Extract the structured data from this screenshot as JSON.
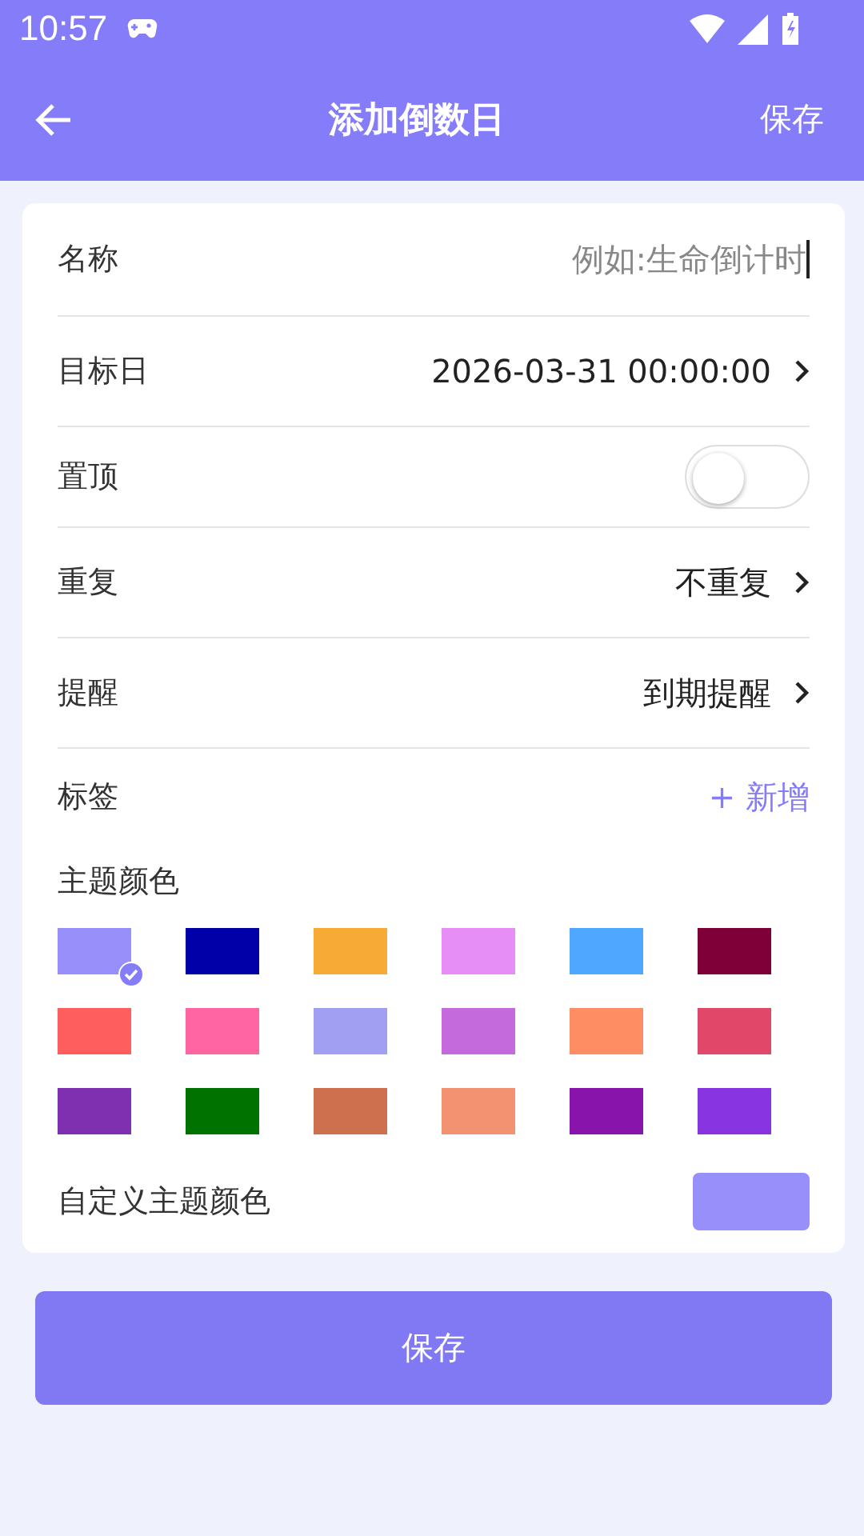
{
  "status_bar": {
    "time": "10:57"
  },
  "header": {
    "title": "添加倒数日",
    "action": "保存"
  },
  "rows": [
    {
      "kind": "input",
      "label": "名称",
      "placeholder": "例如:生命倒计时"
    },
    {
      "kind": "value",
      "label": "目标日",
      "value": "2026-03-31 00:00:00"
    },
    {
      "kind": "toggle",
      "label": "置顶",
      "on": false
    },
    {
      "kind": "value",
      "label": "重复",
      "value": "不重复"
    },
    {
      "kind": "value",
      "label": "提醒",
      "value": "到期提醒"
    },
    {
      "kind": "add",
      "label": "标签",
      "value": "+ 新增"
    }
  ],
  "theme": {
    "label": "主题颜色",
    "swatches": [
      {
        "color": "#978ffa",
        "selected": true
      },
      {
        "color": "#0000a8",
        "selected": false
      },
      {
        "color": "#f7aa35",
        "selected": false
      },
      {
        "color": "#e78ef6",
        "selected": false
      },
      {
        "color": "#4fa7ff",
        "selected": false
      },
      {
        "color": "#7f0038",
        "selected": false
      },
      {
        "color": "#ff5e5e",
        "selected": false
      },
      {
        "color": "#ff65a0",
        "selected": false
      },
      {
        "color": "#a09ff2",
        "selected": false
      },
      {
        "color": "#c56adc",
        "selected": false
      },
      {
        "color": "#ff8d64",
        "selected": false
      },
      {
        "color": "#e04768",
        "selected": false
      },
      {
        "color": "#7f30b0",
        "selected": false
      },
      {
        "color": "#007200",
        "selected": false
      },
      {
        "color": "#cd704e",
        "selected": false
      },
      {
        "color": "#f29270",
        "selected": false
      },
      {
        "color": "#8814ac",
        "selected": false
      },
      {
        "color": "#8834e0",
        "selected": false
      }
    ]
  },
  "custom_theme": {
    "label": "自定义主题颜色",
    "color": "#978ffa"
  },
  "save_button": "保存"
}
